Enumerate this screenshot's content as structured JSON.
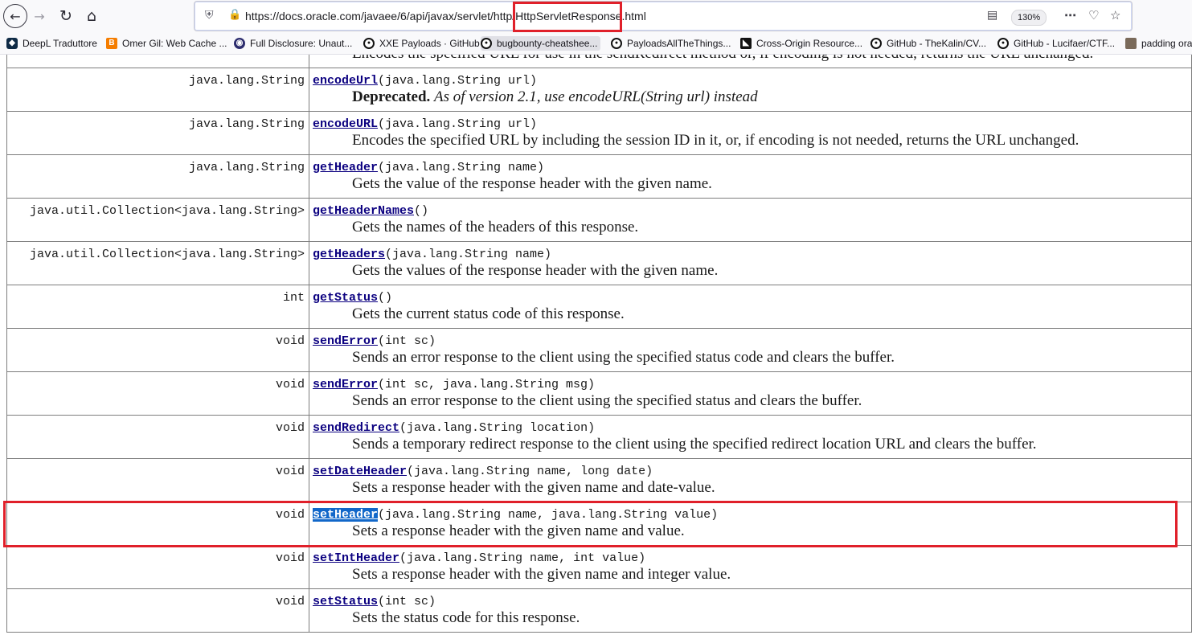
{
  "browser": {
    "url_prefix": "https://docs.oracle.com/javaee/6/api/javax/servlet/http/",
    "url_highlight": "HttpServletResponse",
    "url_suffix": ".html",
    "zoom": "130%"
  },
  "bookmarks": [
    {
      "label": "DeepL Traduttore",
      "icon": "deepl-icon"
    },
    {
      "label": "Omer Gil: Web Cache ...",
      "icon": "blogger-icon"
    },
    {
      "label": "Full Disclosure: Unaut...",
      "icon": "eye-icon"
    },
    {
      "label": "XXE Payloads · GitHub",
      "icon": "github-icon"
    },
    {
      "label": "bugbounty-cheatshee...",
      "icon": "github-icon"
    },
    {
      "label": "PayloadsAllTheThings...",
      "icon": "github-icon"
    },
    {
      "label": "Cross-Origin Resource...",
      "icon": "cors-icon"
    },
    {
      "label": "GitHub - TheKalin/CV...",
      "icon": "github-icon"
    },
    {
      "label": "GitHub - Lucifaer/CTF...",
      "icon": "github-icon"
    },
    {
      "label": "padding ora",
      "icon": "avatar-icon"
    }
  ],
  "page": {
    "partial_top_desc": "Encodes the specified URL for use in the sendRedirect method or, if encoding is not needed, returns the URL unchanged.",
    "rows": [
      {
        "type": "java.lang.String",
        "name": "encodeUrl",
        "params": "(java.lang.String url)",
        "desc": "",
        "dep_label": "Deprecated.",
        "dep_note": "As of version 2.1, use encodeURL(String url) instead"
      },
      {
        "type": "java.lang.String",
        "name": "encodeURL",
        "params": "(java.lang.String url)",
        "desc": "Encodes the specified URL by including the session ID in it, or, if encoding is not needed, returns the URL unchanged."
      },
      {
        "type": "java.lang.String",
        "name": "getHeader",
        "params": "(java.lang.String name)",
        "desc": "Gets the value of the response header with the given name."
      },
      {
        "type": "java.util.Collection<java.lang.String>",
        "name": "getHeaderNames",
        "params": "()",
        "desc": "Gets the names of the headers of this response."
      },
      {
        "type": "java.util.Collection<java.lang.String>",
        "name": "getHeaders",
        "params": "(java.lang.String name)",
        "desc": "Gets the values of the response header with the given name."
      },
      {
        "type": "int",
        "name": "getStatus",
        "params": "()",
        "desc": "Gets the current status code of this response."
      },
      {
        "type": "void",
        "name": "sendError",
        "params": "(int sc)",
        "desc": "Sends an error response to the client using the specified status code and clears the buffer."
      },
      {
        "type": "void",
        "name": "sendError",
        "params": "(int sc, java.lang.String msg)",
        "desc": "Sends an error response to the client using the specified status and clears the buffer."
      },
      {
        "type": "void",
        "name": "sendRedirect",
        "params": "(java.lang.String location)",
        "desc": "Sends a temporary redirect response to the client using the specified redirect location URL and clears the buffer."
      },
      {
        "type": "void",
        "name": "setDateHeader",
        "params": "(java.lang.String name, long date)",
        "desc": "Sets a response header with the given name and date-value."
      },
      {
        "type": "void",
        "name": "setHeader",
        "params": "(java.lang.String name, java.lang.String value)",
        "desc": "Sets a response header with the given name and value.",
        "selected": true
      },
      {
        "type": "void",
        "name": "setIntHeader",
        "params": "(java.lang.String name, int value)",
        "desc": "Sets a response header with the given name and integer value."
      },
      {
        "type": "void",
        "name": "setStatus",
        "params": "(int sc)",
        "desc": "Sets the status code for this response."
      }
    ]
  },
  "colors": {
    "highlight_red": "#e0202a",
    "selection_blue": "#1167c9"
  }
}
